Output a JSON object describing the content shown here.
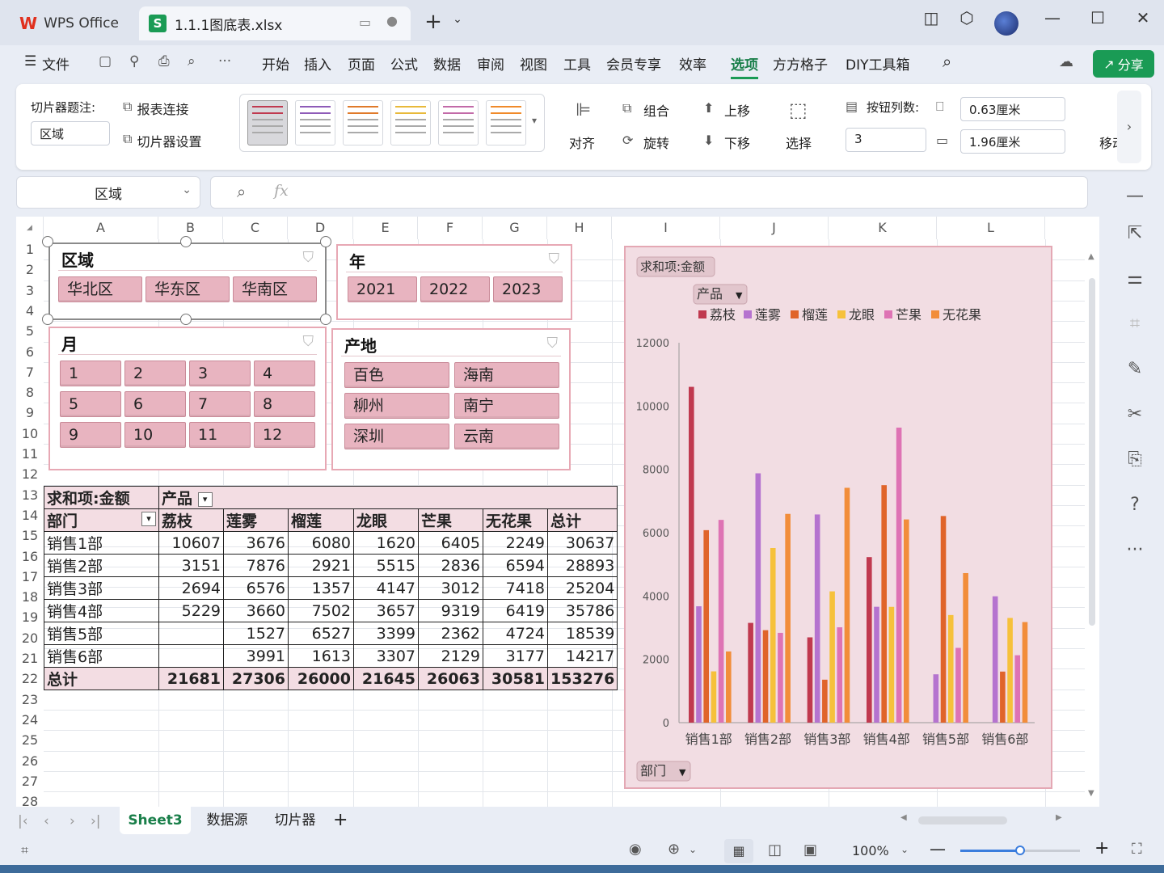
{
  "tabs": {
    "app": "WPS Office",
    "file": "1.1.1图底表.xlsx"
  },
  "menu": [
    "文件",
    "开始",
    "插入",
    "页面",
    "公式",
    "数据",
    "审阅",
    "视图",
    "工具",
    "会员专享",
    "效率",
    "选项",
    "方方格子",
    "DIY工具箱"
  ],
  "menu_active": "选项",
  "share_label": "分享",
  "ribbon": {
    "caption_label": "切片器题注:",
    "caption_value": "区域",
    "report_link": "报表连接",
    "slicer_settings": "切片器设置",
    "align": "对齐",
    "group": "组合",
    "rotate": "旋转",
    "bring_forward": "上移",
    "send_backward": "下移",
    "select": "选择",
    "columns_label": "按钮列数:",
    "columns_value": "3",
    "height_value": "0.63厘米",
    "width_value": "1.96厘米",
    "move_label": "移动"
  },
  "namebox": "区域",
  "fx_label": "fx",
  "columns": [
    "A",
    "B",
    "C",
    "D",
    "E",
    "F",
    "G",
    "H",
    "I",
    "J",
    "K",
    "L"
  ],
  "rows": [
    "1",
    "2",
    "3",
    "4",
    "5",
    "6",
    "7",
    "8",
    "9",
    "10",
    "11",
    "12",
    "13",
    "14",
    "15",
    "16",
    "17",
    "18",
    "19",
    "20",
    "21",
    "22",
    "23",
    "24",
    "25",
    "26",
    "27",
    "28"
  ],
  "slicers": {
    "region": {
      "title": "区域",
      "items": [
        "华北区",
        "华东区",
        "华南区"
      ]
    },
    "year": {
      "title": "年",
      "items": [
        "2021",
        "2022",
        "2023"
      ]
    },
    "month": {
      "title": "月",
      "items": [
        "1",
        "2",
        "3",
        "4",
        "5",
        "6",
        "7",
        "8",
        "9",
        "10",
        "11",
        "12"
      ]
    },
    "origin": {
      "title": "产地",
      "items": [
        "百色",
        "海南",
        "柳州",
        "南宁",
        "深圳",
        "云南"
      ]
    }
  },
  "pivot": {
    "corner": "求和项:金额",
    "col_field": "产品",
    "row_field": "部门",
    "headers": [
      "荔枝",
      "莲雾",
      "榴莲",
      "龙眼",
      "芒果",
      "无花果",
      "总计"
    ],
    "rows": [
      {
        "label": "销售1部",
        "values": [
          "10607",
          "3676",
          "6080",
          "1620",
          "6405",
          "2249",
          "30637"
        ]
      },
      {
        "label": "销售2部",
        "values": [
          "3151",
          "7876",
          "2921",
          "5515",
          "2836",
          "6594",
          "28893"
        ]
      },
      {
        "label": "销售3部",
        "values": [
          "2694",
          "6576",
          "1357",
          "4147",
          "3012",
          "7418",
          "25204"
        ]
      },
      {
        "label": "销售4部",
        "values": [
          "5229",
          "3660",
          "7502",
          "3657",
          "9319",
          "6419",
          "35786"
        ]
      },
      {
        "label": "销售5部",
        "values": [
          "",
          "1527",
          "6527",
          "3399",
          "2362",
          "4724",
          "18539"
        ]
      },
      {
        "label": "销售6部",
        "values": [
          "",
          "3991",
          "1613",
          "3307",
          "2129",
          "3177",
          "14217"
        ]
      }
    ],
    "total": {
      "label": "总计",
      "values": [
        "21681",
        "27306",
        "26000",
        "21645",
        "26063",
        "30581",
        "153276"
      ]
    }
  },
  "chart_data": {
    "type": "bar",
    "title": "求和项:金额",
    "legend_field": "产品",
    "axis_field": "部门",
    "categories": [
      "销售1部",
      "销售2部",
      "销售3部",
      "销售4部",
      "销售5部",
      "销售6部"
    ],
    "ylim": [
      0,
      12000
    ],
    "yticks": [
      0,
      2000,
      4000,
      6000,
      8000,
      10000,
      12000
    ],
    "legend_position": "top",
    "series": [
      {
        "name": "荔枝",
        "color": "#c0394f",
        "values": [
          10607,
          3151,
          2694,
          5229,
          0,
          0
        ]
      },
      {
        "name": "莲雾",
        "color": "#b573cf",
        "values": [
          3676,
          7876,
          6576,
          3660,
          1527,
          3991
        ]
      },
      {
        "name": "榴莲",
        "color": "#e0642a",
        "values": [
          6080,
          2921,
          1357,
          7502,
          6527,
          1613
        ]
      },
      {
        "name": "龙眼",
        "color": "#f6c13b",
        "values": [
          1620,
          5515,
          4147,
          3657,
          3399,
          3307
        ]
      },
      {
        "name": "芒果",
        "color": "#de73b4",
        "values": [
          6405,
          2836,
          3012,
          9319,
          2362,
          2129
        ]
      },
      {
        "name": "无花果",
        "color": "#f28d3a",
        "values": [
          2249,
          6594,
          7418,
          6419,
          4724,
          3177
        ]
      }
    ]
  },
  "sheet_tabs": [
    "Sheet3",
    "数据源",
    "切片器"
  ],
  "active_sheet": "Sheet3",
  "zoom": "100%"
}
